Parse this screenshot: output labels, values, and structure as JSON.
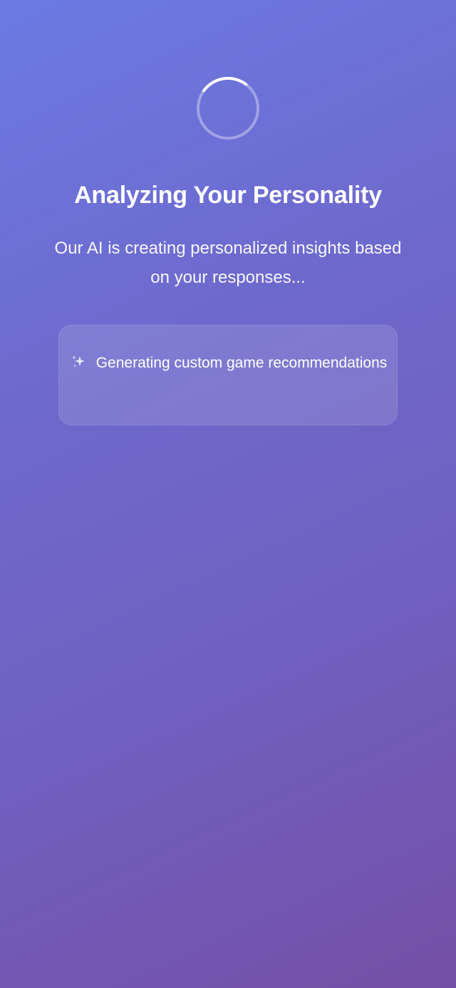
{
  "loading": {
    "spinner_icon": "spinner-icon",
    "title": "Analyzing Your Personality",
    "subtitle": "Our AI is creating personalized insights based on your responses...",
    "status_card": {
      "icon": "sparkle-icon",
      "text": "Generating custom game recommendations"
    }
  },
  "colors": {
    "gradient_start": "#6b7ae3",
    "gradient_end": "#744fa6",
    "text": "#ffffff"
  }
}
